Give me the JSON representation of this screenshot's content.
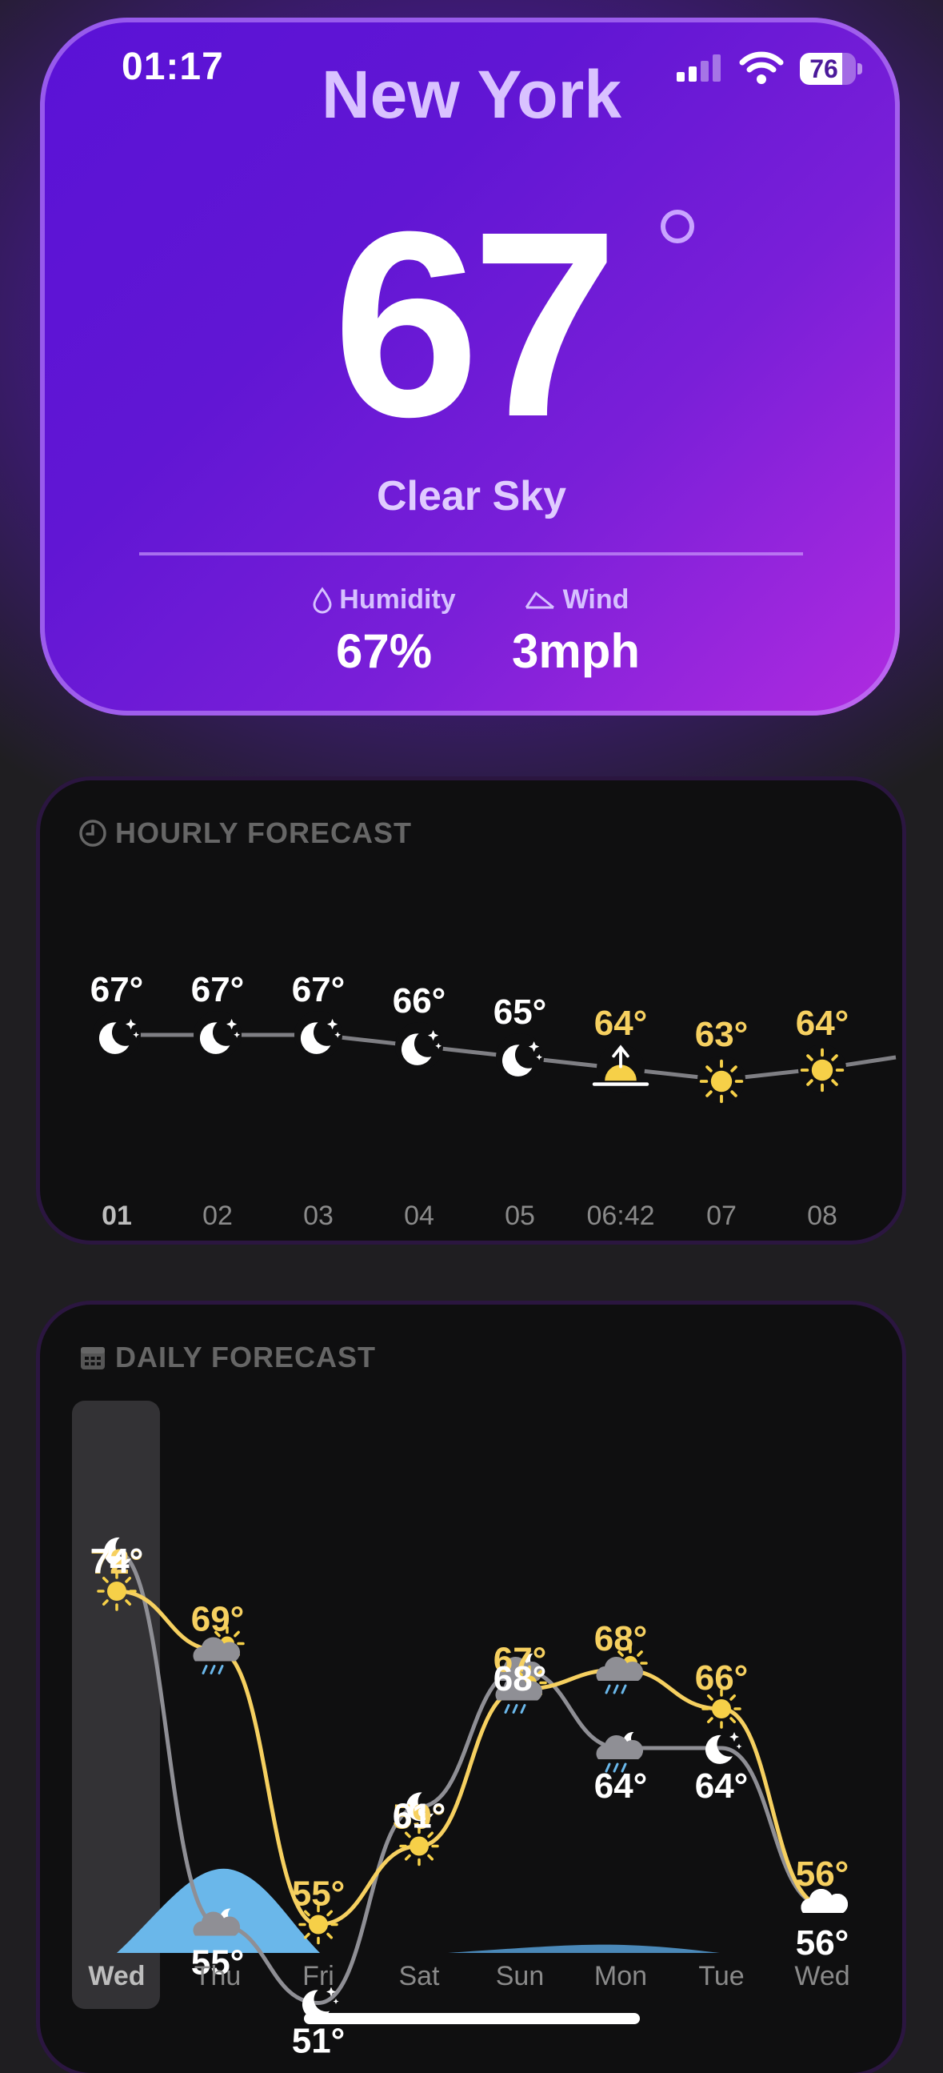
{
  "status_bar": {
    "time": "01:17",
    "battery": "76"
  },
  "current": {
    "city": "New York",
    "temperature": "67",
    "condition": "Clear Sky",
    "humidity_label": "Humidity",
    "humidity_value": "67%",
    "wind_label": "Wind",
    "wind_value": "3mph"
  },
  "hourly": {
    "title": "HOURLY FORECAST",
    "items": [
      {
        "time": "01",
        "temp": "67°",
        "icon": "moon-stars-icon"
      },
      {
        "time": "02",
        "temp": "67°",
        "icon": "moon-stars-icon"
      },
      {
        "time": "03",
        "temp": "67°",
        "icon": "moon-stars-icon"
      },
      {
        "time": "04",
        "temp": "66°",
        "icon": "moon-stars-icon"
      },
      {
        "time": "05",
        "temp": "65°",
        "icon": "moon-stars-icon"
      },
      {
        "time": "06:42",
        "temp": "64°",
        "icon": "sunrise-icon"
      },
      {
        "time": "07",
        "temp": "63°",
        "icon": "sun-icon"
      },
      {
        "time": "08",
        "temp": "64°",
        "icon": "sun-icon"
      }
    ]
  },
  "daily": {
    "title": "DAILY FORECAST",
    "days": [
      {
        "day": "Wed",
        "high": "72°",
        "low": "74°",
        "day_icon": "sun-icon",
        "night_icon": "moon-icon"
      },
      {
        "day": "Thu",
        "high": "69°",
        "low": "55°",
        "day_icon": "cloud-sun-rain-icon",
        "night_icon": "cloud-moon-rain-icon"
      },
      {
        "day": "Fri",
        "high": "55°",
        "low": "51°",
        "day_icon": "sun-icon",
        "night_icon": "moon-stars-icon"
      },
      {
        "day": "Sat",
        "high": "59°",
        "low": "61°",
        "day_icon": "sun-icon",
        "night_icon": "moon-icon"
      },
      {
        "day": "Sun",
        "high": "67°",
        "low": "68°",
        "day_icon": "cloud-sun-rain-icon",
        "night_icon": "cloud-moon-rain-icon"
      },
      {
        "day": "Mon",
        "high": "68°",
        "low": "64°",
        "day_icon": "cloud-sun-rain-icon",
        "night_icon": "cloud-moon-rain-icon"
      },
      {
        "day": "Tue",
        "high": "66°",
        "low": "64°",
        "day_icon": "sun-icon",
        "night_icon": "moon-stars-icon"
      },
      {
        "day": "Wed",
        "high": "56°",
        "low": "56°",
        "day_icon": "cloud-icon",
        "night_icon": "cloud-icon"
      }
    ]
  },
  "chart_data": [
    {
      "type": "line",
      "title": "HOURLY FORECAST",
      "categories": [
        "01",
        "02",
        "03",
        "04",
        "05",
        "06:42",
        "07",
        "08"
      ],
      "series": [
        {
          "values": [
            67,
            67,
            67,
            66,
            65,
            64,
            63,
            64
          ]
        }
      ]
    },
    {
      "type": "line",
      "title": "DAILY FORECAST",
      "categories": [
        "Wed",
        "Thu",
        "Fri",
        "Sat",
        "Sun",
        "Mon",
        "Tue",
        "Wed"
      ],
      "series": [
        {
          "values": [
            72,
            69,
            55,
            59,
            67,
            68,
            66,
            56
          ]
        },
        {
          "values": [
            74,
            55,
            51,
            61,
            68,
            64,
            64,
            56
          ]
        }
      ]
    }
  ],
  "colors": {
    "accent": "#7a1fd8",
    "high": "#f6d060",
    "low": "#ffffff",
    "precip": "#6ab7ea"
  }
}
